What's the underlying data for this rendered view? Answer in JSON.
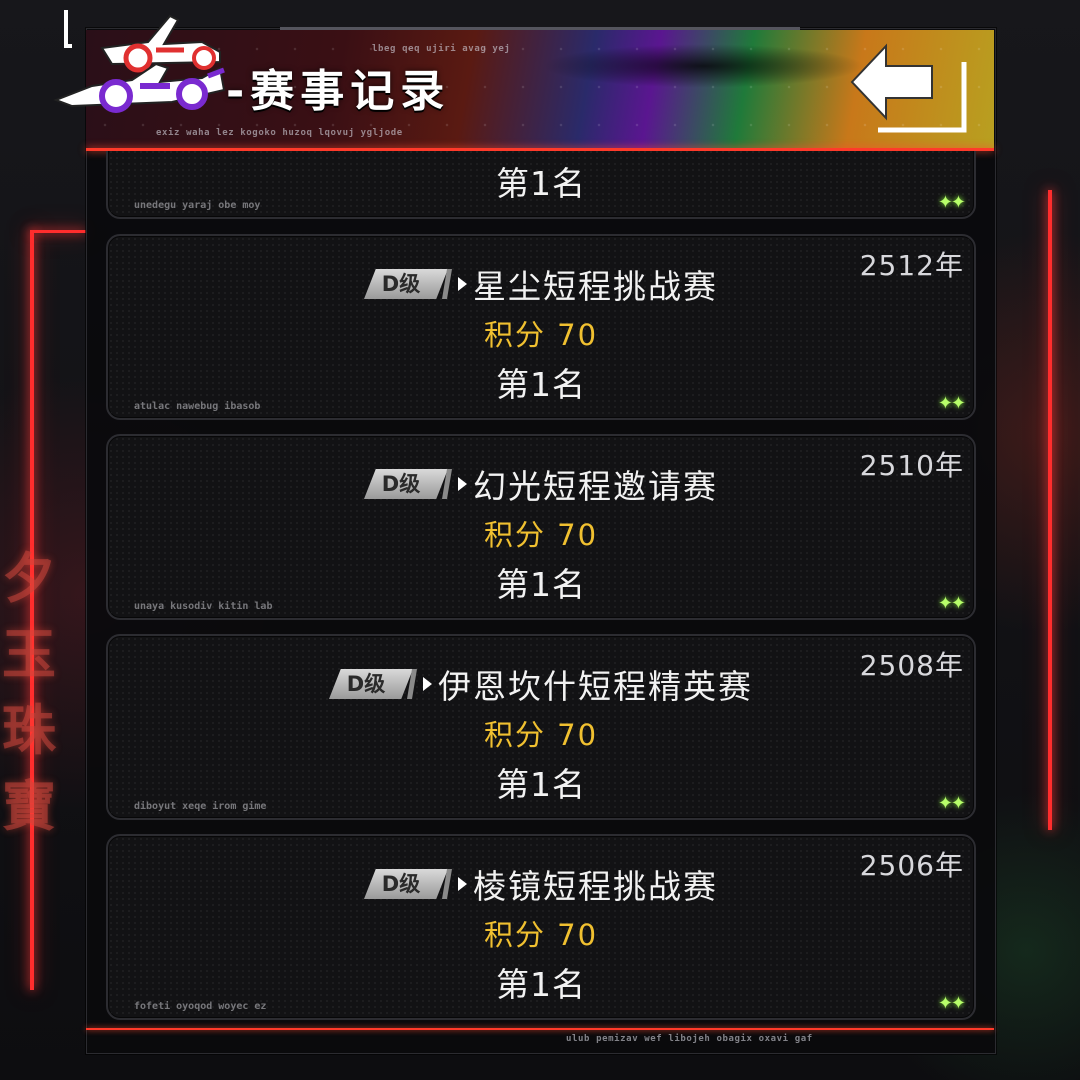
{
  "header": {
    "title": "-赛事记录",
    "micro_top": "lbeg qeq ujiri avag yej",
    "micro_bottom": "exiz waha lez kogoko huzoq lqovuj ygljode"
  },
  "footer": {
    "micro": "ulub pemizav wef libojeh obagix oxavi gaf"
  },
  "background": {
    "glyphs": [
      "夕",
      "玉",
      "珠",
      "寶"
    ]
  },
  "partial_card": {
    "rank": "第1名",
    "code": "unedegu yaraj obe moy"
  },
  "records": [
    {
      "year": "2512年",
      "grade": "D级",
      "race_name": "星尘短程挑战赛",
      "score": "积分 70",
      "rank": "第1名",
      "code": "atulac nawebug ibasob"
    },
    {
      "year": "2510年",
      "grade": "D级",
      "race_name": "幻光短程邀请赛",
      "score": "积分 70",
      "rank": "第1名",
      "code": "unaya kusodiv kitin lab"
    },
    {
      "year": "2508年",
      "grade": "D级",
      "race_name": "伊恩坎什短程精英赛",
      "score": "积分 70",
      "rank": "第1名",
      "code": "diboyut xeqe irom gime"
    },
    {
      "year": "2506年",
      "grade": "D级",
      "race_name": "棱镜短程挑战赛",
      "score": "积分 70",
      "rank": "第1名",
      "code": "fofeti oyoqod woyec ez"
    }
  ],
  "colors": {
    "neon_red": "#ff2d2d",
    "score_gold": "#f0c030",
    "sparkle_green": "#b8ff6a"
  },
  "icons": {
    "back": "back-arrow-icon",
    "logo": "race-car-logo-icon",
    "sparkle": "sparkle-icon"
  }
}
